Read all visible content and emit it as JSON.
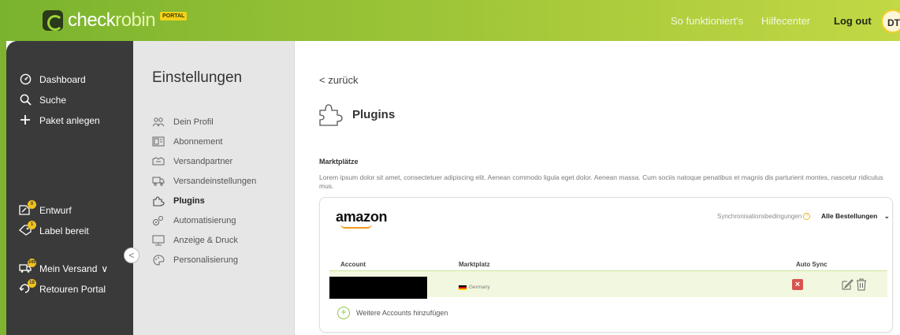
{
  "header": {
    "logo": {
      "part1": "check",
      "part2": "robin",
      "badge": "PORTAL"
    },
    "links": [
      "So funktioniert's",
      "Hilfecenter"
    ],
    "logout_label": "Log out",
    "avatar_initials": "DT"
  },
  "sidebar": {
    "top_items": [
      {
        "label": "Dashboard",
        "icon": "gauge-icon"
      },
      {
        "label": "Suche",
        "icon": "search-icon"
      },
      {
        "label": "Paket anlegen",
        "icon": "plus-icon"
      }
    ],
    "status_items": [
      {
        "label": "Entwurf",
        "icon": "draft-icon",
        "badge": "0"
      },
      {
        "label": "Label bereit",
        "icon": "label-icon",
        "badge": "1"
      }
    ],
    "bottom_items": [
      {
        "label": "Mein Versand",
        "icon": "shipping-icon",
        "badge": "349",
        "chevron": "∨"
      },
      {
        "label": "Retouren Portal",
        "icon": "return-icon",
        "badge": "18"
      }
    ],
    "collapse_glyph": "<"
  },
  "settings": {
    "title": "Einstellungen",
    "items": [
      {
        "label": "Dein Profil",
        "icon": "profile-icon"
      },
      {
        "label": "Abonnement",
        "icon": "subscription-icon"
      },
      {
        "label": "Versandpartner",
        "icon": "partner-icon"
      },
      {
        "label": "Versandeinstellungen",
        "icon": "shipping-settings-icon"
      },
      {
        "label": "Plugins",
        "icon": "puzzle-icon",
        "active": true
      },
      {
        "label": "Automatisierung",
        "icon": "automation-icon"
      },
      {
        "label": "Anzeige & Druck",
        "icon": "monitor-icon"
      },
      {
        "label": "Personalisierung",
        "icon": "palette-icon"
      }
    ]
  },
  "main": {
    "back_label": "< zurück",
    "page_title": "Plugins",
    "section_title": "Marktplätze",
    "description": "Lorem ipsum dolor sit amet, consectetuer adipiscing elit. Aenean commodo ligula eget dolor. Aenean massa. Cum sociis natoque penatibus et magnis dis parturient montes, nascetur ridiculus mus.",
    "card": {
      "logo_text": "amazon",
      "sync_label": "Synchronisationsbedingungen",
      "help_glyph": "?",
      "sync_value": "Alle Bestellungen",
      "sync_chevron": "⌄",
      "columns": {
        "account": "Account",
        "market": "Marktplatz",
        "autosync": "Auto Sync"
      },
      "rows": [
        {
          "account": "",
          "market": "Germany",
          "autosync": "off"
        }
      ],
      "add_label": "Weitere Accounts hinzufügen"
    }
  },
  "colors": {
    "accent_green": "#8cc63f",
    "sidebar_bg": "#3a3a3a",
    "badge_yellow": "#f2c21b",
    "row_highlight": "#f2f8df",
    "danger_red": "#d9534f"
  }
}
